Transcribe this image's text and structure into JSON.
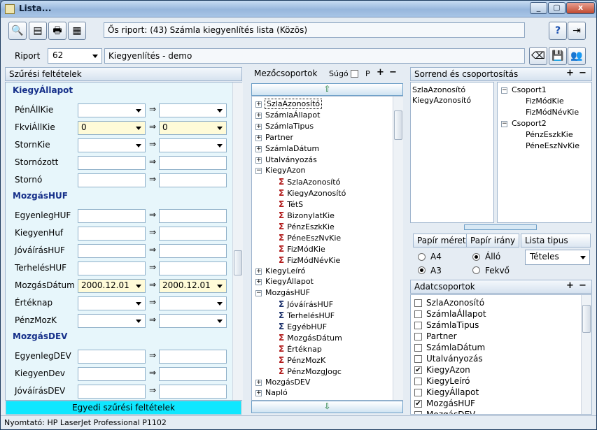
{
  "window": {
    "title": "Lista...",
    "min": "_",
    "max": "▢",
    "close": "x"
  },
  "report_title": "Ős riport: (43)  Számla kiegyenlítés lista (Közös)",
  "riport": {
    "label": "Riport",
    "value": "62",
    "name": "Kiegyenlítés - demo"
  },
  "filters": {
    "header": "Szűrési feltételek",
    "arrow": "⇒",
    "sections": [
      {
        "title": "KiegyÁllapot",
        "rows": [
          {
            "label": "PénÁllKie",
            "type": "combo",
            "from": "",
            "to": ""
          },
          {
            "label": "FkviÁllKie",
            "type": "combo",
            "from": "0",
            "to": "0",
            "highlight": true
          },
          {
            "label": "StornKie",
            "type": "combo",
            "from": "",
            "to": ""
          },
          {
            "label": "Stornózott",
            "type": "text",
            "from": "",
            "to": ""
          },
          {
            "label": "Stornó",
            "type": "text",
            "from": "",
            "to": ""
          }
        ]
      },
      {
        "title": "MozgásHUF",
        "rows": [
          {
            "label": "EgyenlegHUF",
            "type": "text",
            "from": "",
            "to": ""
          },
          {
            "label": "KiegyenHuf",
            "type": "text",
            "from": "",
            "to": ""
          },
          {
            "label": "JóváírásHUF",
            "type": "text",
            "from": "",
            "to": ""
          },
          {
            "label": "TerhelésHUF",
            "type": "text",
            "from": "",
            "to": ""
          },
          {
            "label": "MozgásDátum",
            "type": "combo",
            "from": "2000.12.01",
            "to": "2000.12.01",
            "highlight": true
          },
          {
            "label": "Értéknap",
            "type": "combo",
            "from": "",
            "to": ""
          },
          {
            "label": "PénzMozK",
            "type": "combo",
            "from": "",
            "to": ""
          }
        ]
      },
      {
        "title": "MozgásDEV",
        "rows": [
          {
            "label": "EgyenlegDEV",
            "type": "text",
            "from": "",
            "to": ""
          },
          {
            "label": "KiegyenDev",
            "type": "text",
            "from": "",
            "to": ""
          },
          {
            "label": "JóváírásDEV",
            "type": "text",
            "from": "",
            "to": ""
          }
        ]
      }
    ],
    "scroll_position": 0.55,
    "footer_button": "Egyedi szűrési feltételek"
  },
  "fields": {
    "header": "Mezőcsoportok",
    "help_label": "Súgó",
    "p_label": "P",
    "plus": "+",
    "minus": "−",
    "items": [
      {
        "label": "SzlaAzonosító",
        "expand": "+",
        "selected": true
      },
      {
        "label": "SzámlaÁllapot",
        "expand": "+"
      },
      {
        "label": "SzámlaTipus",
        "expand": "+"
      },
      {
        "label": "Partner",
        "expand": "+"
      },
      {
        "label": "SzámlaDátum",
        "expand": "+"
      },
      {
        "label": "Utalványozás",
        "expand": "+"
      },
      {
        "label": "KiegyAzon",
        "expand": "−"
      },
      {
        "label": "SzlaAzonosító",
        "sigma": "r"
      },
      {
        "label": "KiegyAzonosító",
        "sigma": "r"
      },
      {
        "label": "TétS",
        "sigma": "r"
      },
      {
        "label": "BizonylatKie",
        "sigma": "r"
      },
      {
        "label": "PénzEszkKie",
        "sigma": "r"
      },
      {
        "label": "PéneEszNvKie",
        "sigma": "r"
      },
      {
        "label": "FizMódKie",
        "sigma": "r"
      },
      {
        "label": "FizMódNévKie",
        "sigma": "r"
      },
      {
        "label": "KiegyLeíró",
        "expand": "+"
      },
      {
        "label": "KiegyÁllapot",
        "expand": "+"
      },
      {
        "label": "MozgásHUF",
        "expand": "−"
      },
      {
        "label": "JóváírásHUF",
        "sigma": "b"
      },
      {
        "label": "TerhelésHUF",
        "sigma": "b"
      },
      {
        "label": "EgyébHUF",
        "sigma": "b"
      },
      {
        "label": "MozgásDátum",
        "sigma": "r"
      },
      {
        "label": "Értéknap",
        "sigma": "r"
      },
      {
        "label": "PénzMozK",
        "sigma": "r"
      },
      {
        "label": "PénzMozgJogc",
        "sigma": "r"
      },
      {
        "label": "MozgásDEV",
        "expand": "+"
      },
      {
        "label": "Napló",
        "expand": "+"
      }
    ]
  },
  "order": {
    "header": "Sorrend és csoportosítás",
    "plus": "+",
    "minus": "−",
    "sort": [
      "SzlaAzonosító",
      "KiegyAzonosító"
    ],
    "groups": [
      {
        "label": "Csoport1",
        "expand": "−",
        "children": [
          "FizMódKie",
          "FizMódNévKie"
        ]
      },
      {
        "label": "Csoport2",
        "expand": "−",
        "children": [
          "PénzEszkKie",
          "PéneEszNvKie"
        ]
      }
    ]
  },
  "paper": {
    "size_label": "Papír méret",
    "dir_label": "Papír irány",
    "type_label": "Lista tipus",
    "sizes": [
      {
        "label": "A4",
        "checked": false
      },
      {
        "label": "A3",
        "checked": true
      }
    ],
    "dirs": [
      {
        "label": "Álló",
        "checked": true
      },
      {
        "label": "Fekvő",
        "checked": false
      }
    ],
    "list_type": "Tételes"
  },
  "data_groups": {
    "header": "Adatcsoportok",
    "plus": "+",
    "minus": "−",
    "items": [
      {
        "label": "SzlaAzonosító",
        "checked": false
      },
      {
        "label": "SzámlaÁllapot",
        "checked": false
      },
      {
        "label": "SzámlaTipus",
        "checked": false
      },
      {
        "label": "Partner",
        "checked": false
      },
      {
        "label": "SzámlaDátum",
        "checked": false
      },
      {
        "label": "Utalványozás",
        "checked": false
      },
      {
        "label": "KiegyAzon",
        "checked": true
      },
      {
        "label": "KiegyLeíró",
        "checked": false
      },
      {
        "label": "KiegyÁllapot",
        "checked": false
      },
      {
        "label": "MozgásHUF",
        "checked": true
      },
      {
        "label": "MozgásDEV",
        "checked": false
      }
    ]
  },
  "status": "Nyomtató: HP LaserJet Professional P1102",
  "icons": [
    "preview-icon",
    "settings-icon",
    "print-icon",
    "export-icon",
    "help-icon",
    "exit-icon",
    "eraser-icon",
    "save-icon",
    "users-icon"
  ]
}
